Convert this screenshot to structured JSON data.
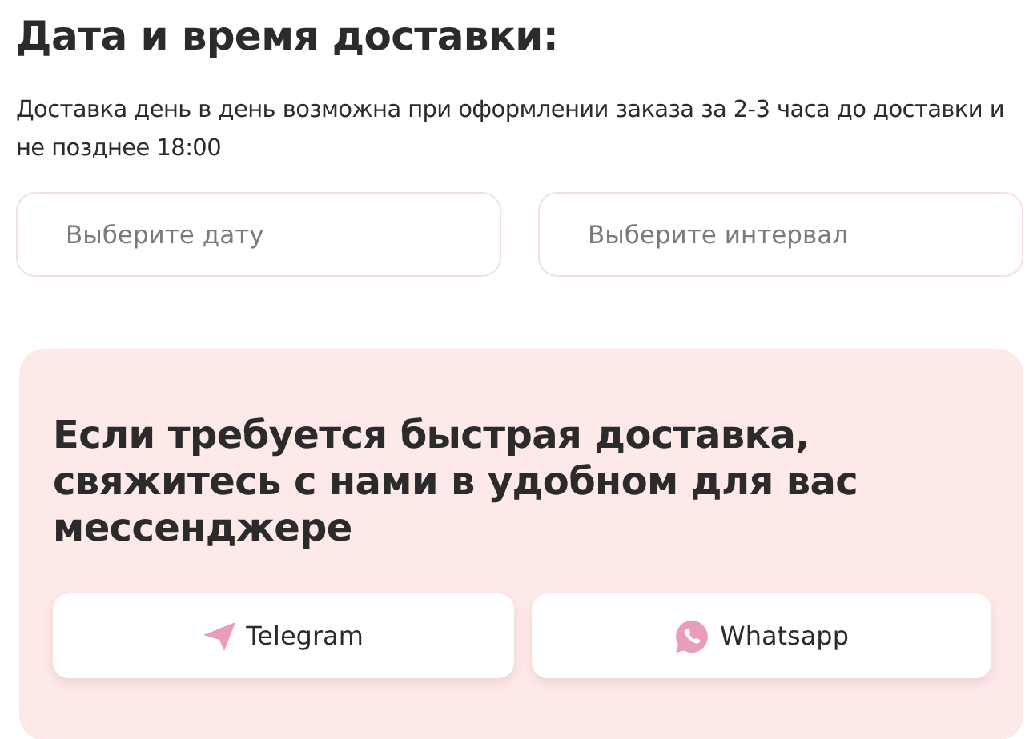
{
  "title": "Дата и время доставки:",
  "note": "Доставка день в день возможна при оформлении заказа за 2-3 часа до доставки и не позднее 18:00",
  "fields": [
    {
      "placeholder": "Выберите дату"
    },
    {
      "placeholder": "Выберите интервал"
    }
  ],
  "promo": {
    "heading": "Если требуется быстрая доставка, свяжитесь с нами в удобном для вас мессенджере",
    "buttons": [
      {
        "kind": "telegram",
        "label": "Telegram"
      },
      {
        "kind": "whatsapp",
        "label": "Whatsapp"
      }
    ]
  }
}
